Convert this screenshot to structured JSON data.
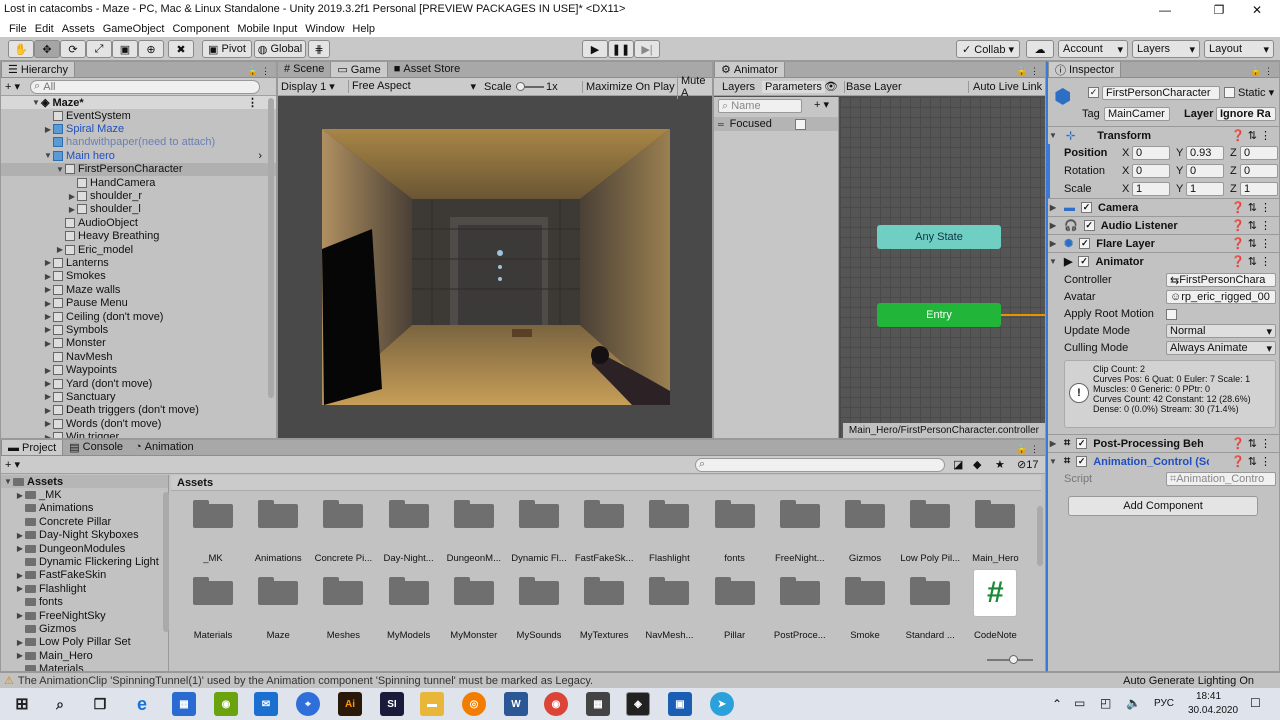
{
  "window": {
    "title": "Lost in catacombs - Maze - PC, Mac & Linux Standalone - Unity 2019.3.2f1 Personal [PREVIEW PACKAGES IN USE]* <DX11>",
    "minimize": "—",
    "maximize": "❐",
    "close": "✕"
  },
  "menu": [
    "File",
    "Edit",
    "Assets",
    "GameObject",
    "Component",
    "Mobile Input",
    "Window",
    "Help"
  ],
  "toolbar": {
    "pivot": "Pivot",
    "global": "Global",
    "collab": "Collab ▾",
    "account": "Account",
    "layers": "Layers",
    "layout": "Layout",
    "play_icon": "play-icon",
    "pause_icon": "pause-icon",
    "step_icon": "step-icon"
  },
  "hierarchy": {
    "tab": "Hierarchy",
    "search_placeholder": "All",
    "add": "+ ▾",
    "scene": "Maze*",
    "items": [
      {
        "label": "EventSystem",
        "depth": 1,
        "arrow": "",
        "style": ""
      },
      {
        "label": "Spiral Maze",
        "depth": 1,
        "arrow": "▶",
        "style": "blue"
      },
      {
        "label": "handwithpaper(need to attach)",
        "depth": 1,
        "arrow": "",
        "style": "grey"
      },
      {
        "label": "Main hero",
        "depth": 1,
        "arrow": "▼",
        "style": "blue"
      },
      {
        "label": "FirstPersonCharacter",
        "depth": 2,
        "arrow": "▼",
        "style": "sel"
      },
      {
        "label": "HandCamera",
        "depth": 3,
        "arrow": "",
        "style": ""
      },
      {
        "label": "shoulder_r",
        "depth": 3,
        "arrow": "▶",
        "style": ""
      },
      {
        "label": "shoulder_l",
        "depth": 3,
        "arrow": "▶",
        "style": ""
      },
      {
        "label": "AudioObject",
        "depth": 2,
        "arrow": "",
        "style": ""
      },
      {
        "label": "Heavy Breathing",
        "depth": 2,
        "arrow": "",
        "style": ""
      },
      {
        "label": "Eric_model",
        "depth": 2,
        "arrow": "▶",
        "style": ""
      },
      {
        "label": "Lanterns",
        "depth": 1,
        "arrow": "▶",
        "style": ""
      },
      {
        "label": "Smokes",
        "depth": 1,
        "arrow": "▶",
        "style": ""
      },
      {
        "label": "Maze walls",
        "depth": 1,
        "arrow": "▶",
        "style": ""
      },
      {
        "label": "Pause Menu",
        "depth": 1,
        "arrow": "▶",
        "style": ""
      },
      {
        "label": "Ceiling (don't move)",
        "depth": 1,
        "arrow": "▶",
        "style": ""
      },
      {
        "label": "Symbols",
        "depth": 1,
        "arrow": "▶",
        "style": ""
      },
      {
        "label": "Monster",
        "depth": 1,
        "arrow": "▶",
        "style": ""
      },
      {
        "label": "NavMesh",
        "depth": 1,
        "arrow": "",
        "style": ""
      },
      {
        "label": "Waypoints",
        "depth": 1,
        "arrow": "▶",
        "style": ""
      },
      {
        "label": "Yard (don't move)",
        "depth": 1,
        "arrow": "▶",
        "style": ""
      },
      {
        "label": "Sanctuary",
        "depth": 1,
        "arrow": "▶",
        "style": ""
      },
      {
        "label": "Death triggers (don't move)",
        "depth": 1,
        "arrow": "▶",
        "style": ""
      },
      {
        "label": "Words (don't move)",
        "depth": 1,
        "arrow": "▶",
        "style": ""
      },
      {
        "label": "Win trigger",
        "depth": 1,
        "arrow": "▶",
        "style": ""
      }
    ]
  },
  "game": {
    "tabs": [
      "Scene",
      "Game",
      "Asset Store"
    ],
    "display": "Display 1",
    "aspect": "Free Aspect",
    "scale_label": "Scale",
    "scale_value": "1x",
    "maximize": "Maximize On Play",
    "mute": "Mute A"
  },
  "animator": {
    "tab": "Animator",
    "layers": "Layers",
    "parameters": "Parameters",
    "base_layer": "Base Layer",
    "auto_live": "Auto Live Link",
    "name_placeholder": "Name",
    "param": "Focused",
    "any_state": "Any State",
    "entry": "Entry",
    "path": "Main_Hero/FirstPersonCharacter.controller"
  },
  "inspector": {
    "tab": "Inspector",
    "object_name": "FirstPersonCharacter",
    "static": "Static",
    "tag_label": "Tag",
    "tag": "MainCamer",
    "layer_label": "Layer",
    "layer": "Ignore Ra",
    "transform": {
      "title": "Transform",
      "position": [
        "0",
        "0.93",
        "0"
      ],
      "rotation": [
        "0",
        "0",
        "0"
      ],
      "scale": [
        "1",
        "1",
        "1"
      ],
      "labels": [
        "Position",
        "Rotation",
        "Scale"
      ],
      "axes": [
        "X",
        "Y",
        "Z"
      ]
    },
    "components": [
      "Camera",
      "Audio Listener",
      "Flare Layer"
    ],
    "animator": {
      "title": "Animator",
      "controller_label": "Controller",
      "controller": "FirstPersonChara",
      "avatar_label": "Avatar",
      "avatar": "rp_eric_rigged_00",
      "root_label": "Apply Root Motion",
      "update_label": "Update Mode",
      "update": "Normal",
      "culling_label": "Culling Mode",
      "culling": "Always Animate",
      "info": [
        "Clip Count: 2",
        "Curves Pos: 6 Quat: 0 Euler: 7 Scale: 1",
        "Muscles: 0 Generic: 0 PPtr: 0",
        "Curves Count: 42 Constant: 12 (28.6%)",
        "Dense: 0 (0.0%) Stream: 30 (71.4%)"
      ]
    },
    "post": "Post-Processing Behaviou",
    "anim_control": "Animation_Control (Script",
    "script_label": "Script",
    "script": "Animation_Contro",
    "add_component": "Add Component"
  },
  "project": {
    "tabs": [
      "Project",
      "Console",
      "Animation"
    ],
    "count": "17",
    "tree": [
      {
        "label": "Assets",
        "depth": 0,
        "arrow": "▼",
        "bold": true
      },
      {
        "label": "_MK",
        "depth": 1,
        "arrow": "▶"
      },
      {
        "label": "Animations",
        "depth": 1,
        "arrow": ""
      },
      {
        "label": "Concrete Pillar",
        "depth": 1,
        "arrow": ""
      },
      {
        "label": "Day-Night Skyboxes",
        "depth": 1,
        "arrow": "▶"
      },
      {
        "label": "DungeonModules",
        "depth": 1,
        "arrow": "▶"
      },
      {
        "label": "Dynamic Flickering Light",
        "depth": 1,
        "arrow": ""
      },
      {
        "label": "FastFakeSkin",
        "depth": 1,
        "arrow": "▶"
      },
      {
        "label": "Flashlight",
        "depth": 1,
        "arrow": "▶"
      },
      {
        "label": "fonts",
        "depth": 1,
        "arrow": ""
      },
      {
        "label": "FreeNightSky",
        "depth": 1,
        "arrow": "▶"
      },
      {
        "label": "Gizmos",
        "depth": 1,
        "arrow": ""
      },
      {
        "label": "Low Poly Pillar Set",
        "depth": 1,
        "arrow": "▶"
      },
      {
        "label": "Main_Hero",
        "depth": 1,
        "arrow": "▶"
      },
      {
        "label": "Materials",
        "depth": 1,
        "arrow": ""
      }
    ],
    "breadcrumb": "Assets",
    "assets_row1": [
      "_MK",
      "Animations",
      "Concrete Pi...",
      "Day-Night...",
      "DungeonM...",
      "Dynamic Fl...",
      "FastFakeSk...",
      "Flashlight",
      "fonts",
      "FreeNight...",
      "Gizmos",
      "Low Poly Pil...",
      "Main_Hero"
    ],
    "assets_row2": [
      "Materials",
      "Maze",
      "Meshes",
      "MyModels",
      "MyMonster",
      "MySounds",
      "MyTextures",
      "NavMesh...",
      "Pillar",
      "PostProce...",
      "Smoke",
      "Standard ..."
    ],
    "codenote": "CodeNote"
  },
  "status": {
    "warning": "The AnimationClip 'SpinningTunnel(1)' used by the Animation component 'Spinning tunnel' must be marked as Legacy.",
    "right": "Auto Generate Lighting On"
  },
  "taskbar": {
    "lang": "РУС",
    "time": "18:41",
    "date": "30.04.2020",
    "icons": [
      "Ai",
      "SI"
    ]
  }
}
